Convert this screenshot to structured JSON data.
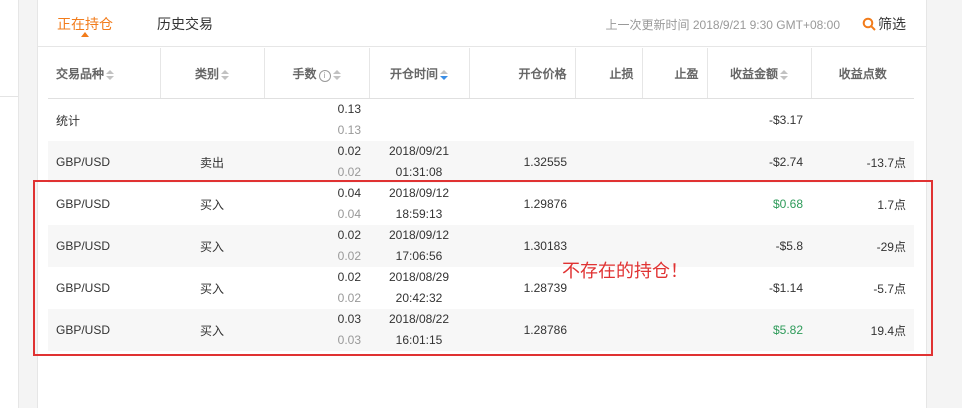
{
  "tabs": {
    "open": "正在持仓",
    "history": "历史交易"
  },
  "last_updated": "上一次更新时间 2018/9/21 9:30 GMT+08:00",
  "filter_label": "筛选",
  "columns": [
    "交易品种",
    "类别",
    "手数",
    "开仓时间",
    "开仓价格",
    "止损",
    "止盈",
    "收益金额",
    "收益点数"
  ],
  "summary": {
    "label": "统计",
    "lots": "0.13",
    "lots_sub": "0.13",
    "profit": "-$3.17"
  },
  "rows": [
    {
      "symbol": "GBP/USD",
      "type": "卖出",
      "lots": "0.02",
      "lots_sub": "0.02",
      "date": "2018/09/21",
      "time": "01:31:08",
      "price": "1.32555",
      "profit": "-$2.74",
      "points": "-13.7点"
    },
    {
      "symbol": "GBP/USD",
      "type": "买入",
      "lots": "0.04",
      "lots_sub": "0.04",
      "date": "2018/09/12",
      "time": "18:59:13",
      "price": "1.29876",
      "profit": "$0.68",
      "points": "1.7点"
    },
    {
      "symbol": "GBP/USD",
      "type": "买入",
      "lots": "0.02",
      "lots_sub": "0.02",
      "date": "2018/09/12",
      "time": "17:06:56",
      "price": "1.30183",
      "profit": "-$5.8",
      "points": "-29点"
    },
    {
      "symbol": "GBP/USD",
      "type": "买入",
      "lots": "0.02",
      "lots_sub": "0.02",
      "date": "2018/08/29",
      "time": "20:42:32",
      "price": "1.28739",
      "profit": "-$1.14",
      "points": "-5.7点"
    },
    {
      "symbol": "GBP/USD",
      "type": "买入",
      "lots": "0.03",
      "lots_sub": "0.03",
      "date": "2018/08/22",
      "time": "16:01:15",
      "price": "1.28786",
      "profit": "$5.82",
      "points": "19.4点"
    }
  ],
  "annotation": "不存在的持仓！",
  "colors": {
    "accent": "#f27c1b",
    "positive": "#2e9b5a",
    "highlight": "#e03232"
  }
}
